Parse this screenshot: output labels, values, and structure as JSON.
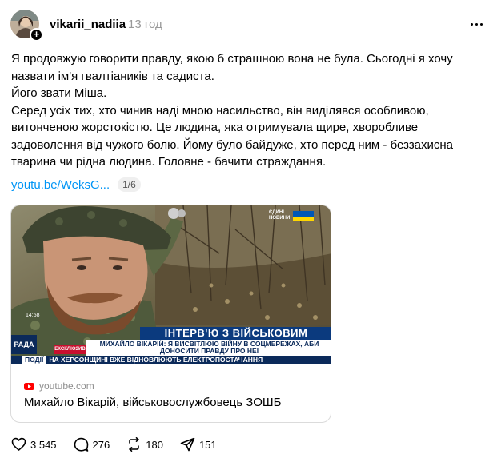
{
  "post": {
    "username": "vikarii_nadiia",
    "timestamp": "13 год",
    "paragraphs": [
      "Я продовжую говорити правду, якою б страшною вона не була. Сьогодні я хочу назвати ім'я гвалтіаників та садиста.",
      "Його звати Міша.",
      "Серед усіх тих, хто чинив наді мною насильство, він виділявся особливою, витонченою жорстокістю. Це людина, яка отримувала щире, хворобливе задоволення від чужого болю. Йому було байдуже, хто перед ним - беззахисна тварина чи рідна людина. Головне - бачити страждання."
    ],
    "link_text": "youtu.be/WeksG...",
    "counter": "1/6"
  },
  "card": {
    "thumbnail": {
      "top_logo": "ЄДИНІ НОВИНИ",
      "clock": "14:58",
      "banner_title": "ІНТЕРВ'Ю З ВІЙСЬКОВИМ",
      "banner_subtitle": "МИХАЙЛО ВІКАРІЙ: Я ВИСВІТЛЮЮ ВІЙНУ В СОЦМЕРЕЖАХ, АБИ ДОНОСИТИ ПРАВДУ ПРО НЕЇ",
      "exclusive_tag": "ЕКСКЛЮЗИВ",
      "channel_logo": "РАДА",
      "ticker_tag": "ПОДІЇ",
      "ticker_text": "НА ХЕРСОНЩИНІ ВЖЕ ВІДНОВЛЮЮТЬ ЕЛЕКТРОПОСТАЧАННЯ"
    },
    "domain": "youtube.com",
    "title": "Михайло Вікарій, військовослужбовець ЗОШБ"
  },
  "actions": {
    "likes": "3 545",
    "comments": "276",
    "reposts": "180",
    "shares": "151"
  },
  "colors": {
    "link": "#0095f6",
    "muted": "#999999",
    "banner_blue": "#0b3a7e",
    "exclusive_red": "#c8102e",
    "youtube_red": "#ff0000"
  }
}
